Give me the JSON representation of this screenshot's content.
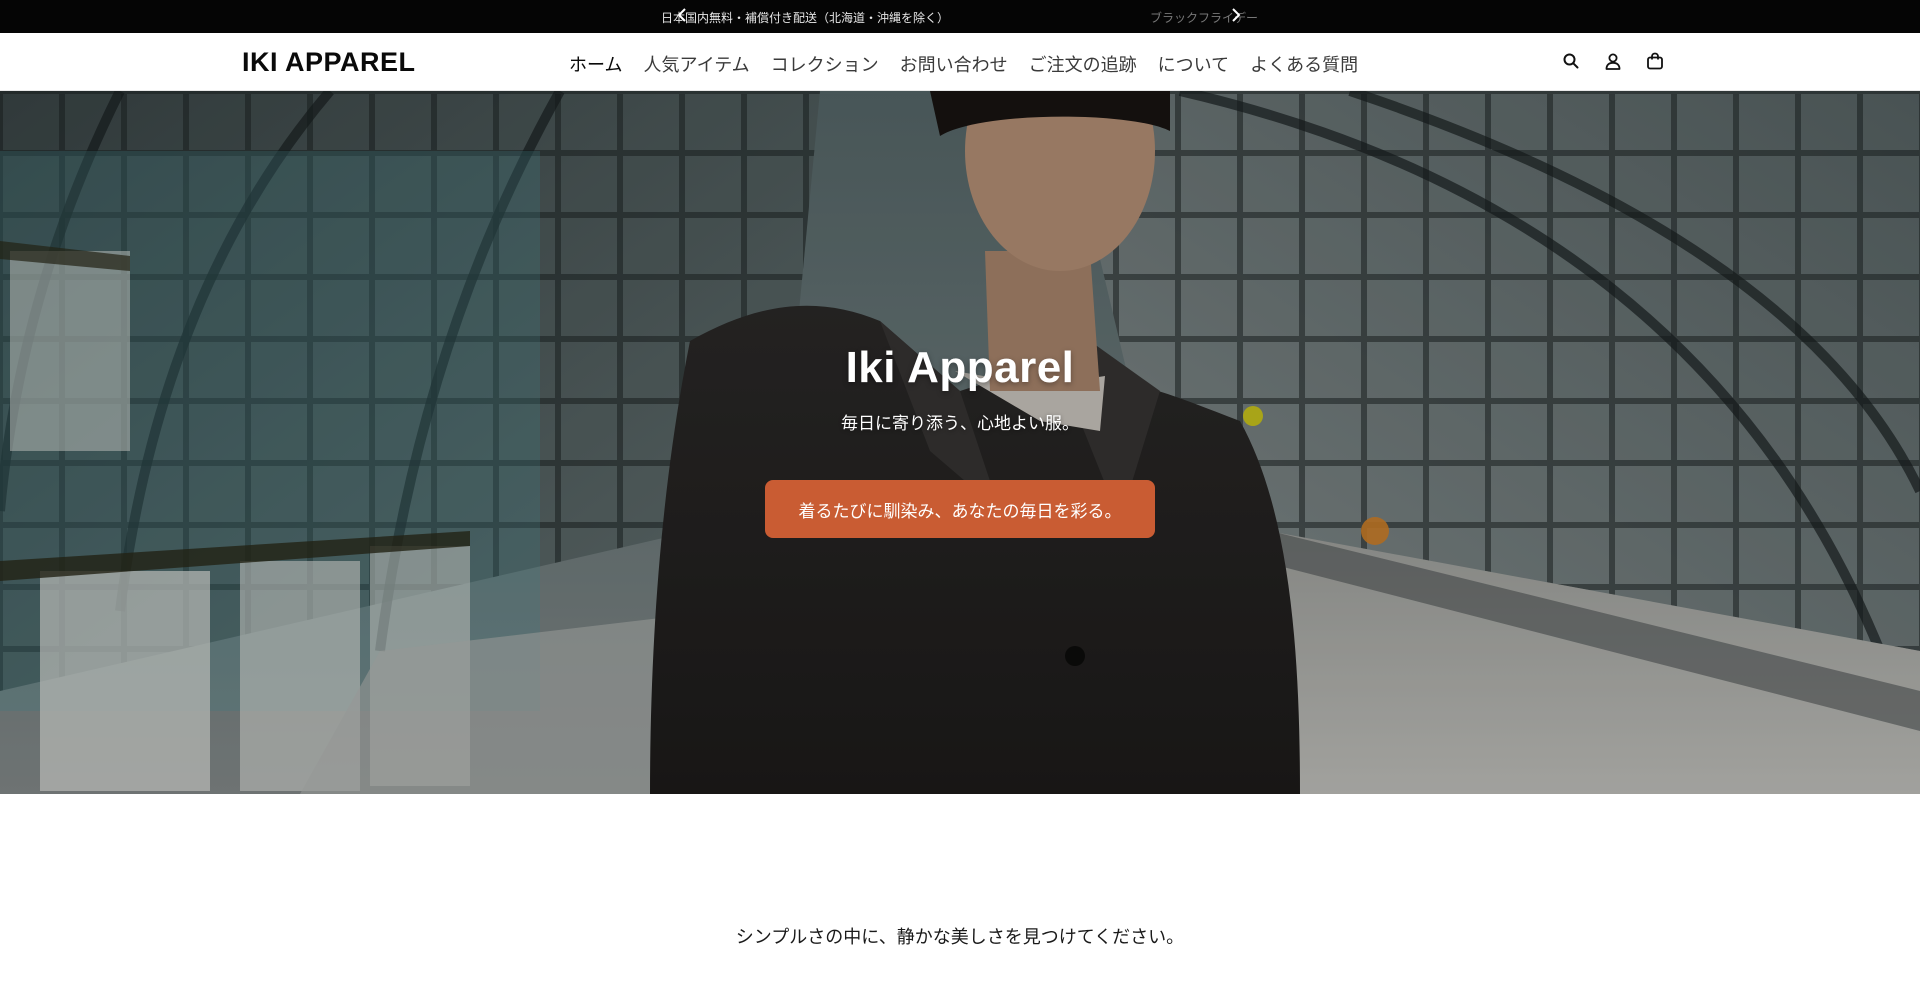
{
  "announcement": {
    "messages": [
      "日本国内無料・補償付き配送（北海道・沖縄を除く）",
      "ブラックフライデー"
    ]
  },
  "header": {
    "logo": "IKI APPAREL",
    "nav": [
      {
        "label": "ホーム",
        "active": true
      },
      {
        "label": "人気アイテム",
        "active": false
      },
      {
        "label": "コレクション",
        "active": false
      },
      {
        "label": "お問い合わせ",
        "active": false
      },
      {
        "label": "ご注文の追跡",
        "active": false
      },
      {
        "label": "について",
        "active": false
      },
      {
        "label": "よくある質問",
        "active": false
      }
    ],
    "icons": [
      "search-icon",
      "account-icon",
      "cart-icon"
    ]
  },
  "hero": {
    "title": "Iki Apparel",
    "subtitle": "毎日に寄り添う、心地よい服。",
    "cta_label": "着るたびに馴染み、あなたの毎日を彩る。",
    "cta_color": "#c95c33"
  },
  "section": {
    "tagline": "シンプルさの中に、静かな美しさを見つけてください。"
  }
}
